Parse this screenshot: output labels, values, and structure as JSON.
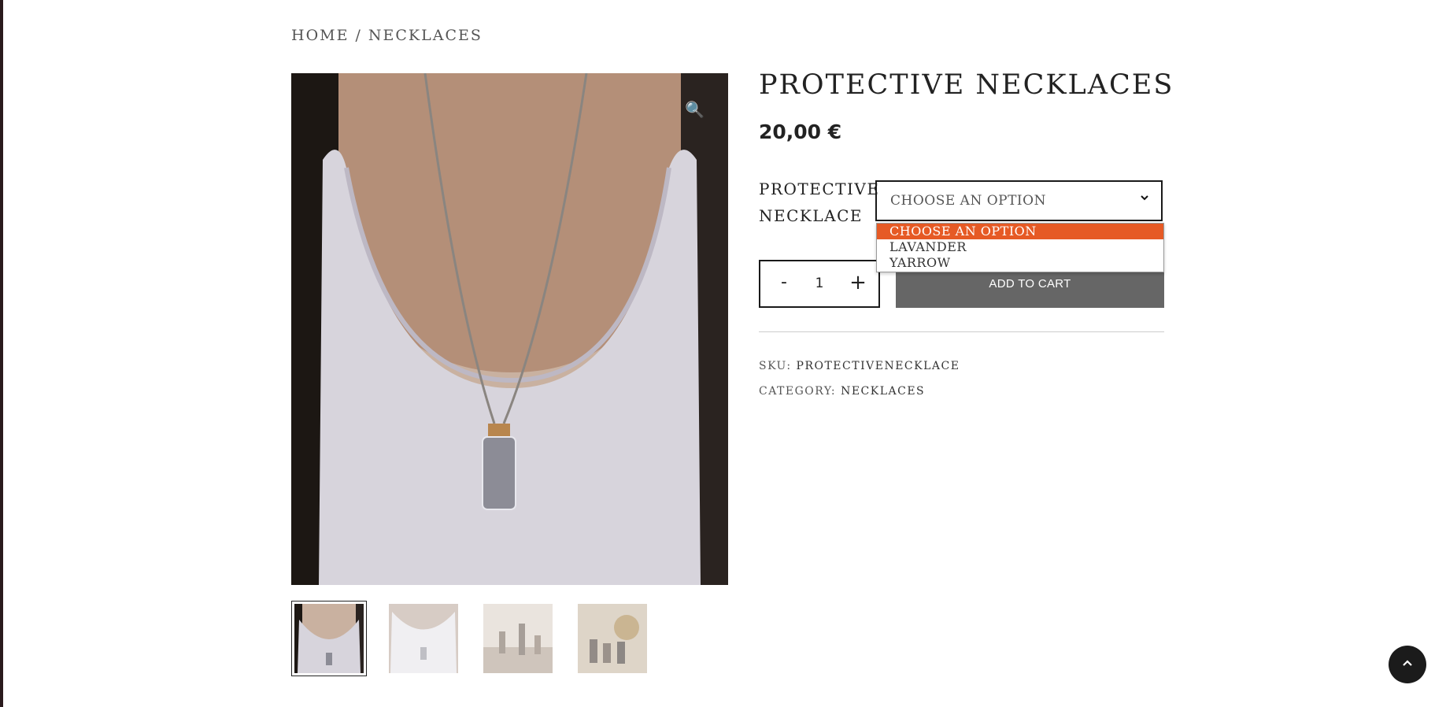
{
  "breadcrumb": {
    "home": "HOME",
    "separator": "/",
    "current": "NECKLACES"
  },
  "gallery": {
    "zoom_icon": "magnifier-icon",
    "thumbnail_count": 4,
    "active_thumbnail": 0
  },
  "product": {
    "title": "PROTECTIVE NECKLACES",
    "price": "20,00 €",
    "variation": {
      "label_line1": "PROTECTIVE",
      "label_line2": "NECKLACE",
      "selected": "CHOOSE AN OPTION",
      "options": [
        "CHOOSE AN OPTION",
        "LAVANDER",
        "YARROW"
      ]
    },
    "quantity": {
      "minus": "-",
      "value": "1",
      "plus": "+"
    },
    "add_to_cart": "ADD TO CART",
    "sku_label": "SKU:",
    "sku_value": "PROTECTIVENECKLACE",
    "category_label": "CATEGORY:",
    "category_value": "NECKLACES"
  },
  "colors": {
    "accent": "#e65a25",
    "button": "#666666",
    "scroll_top": "#1b1b1b"
  },
  "back_to_top_icon": "chevron-up-icon"
}
